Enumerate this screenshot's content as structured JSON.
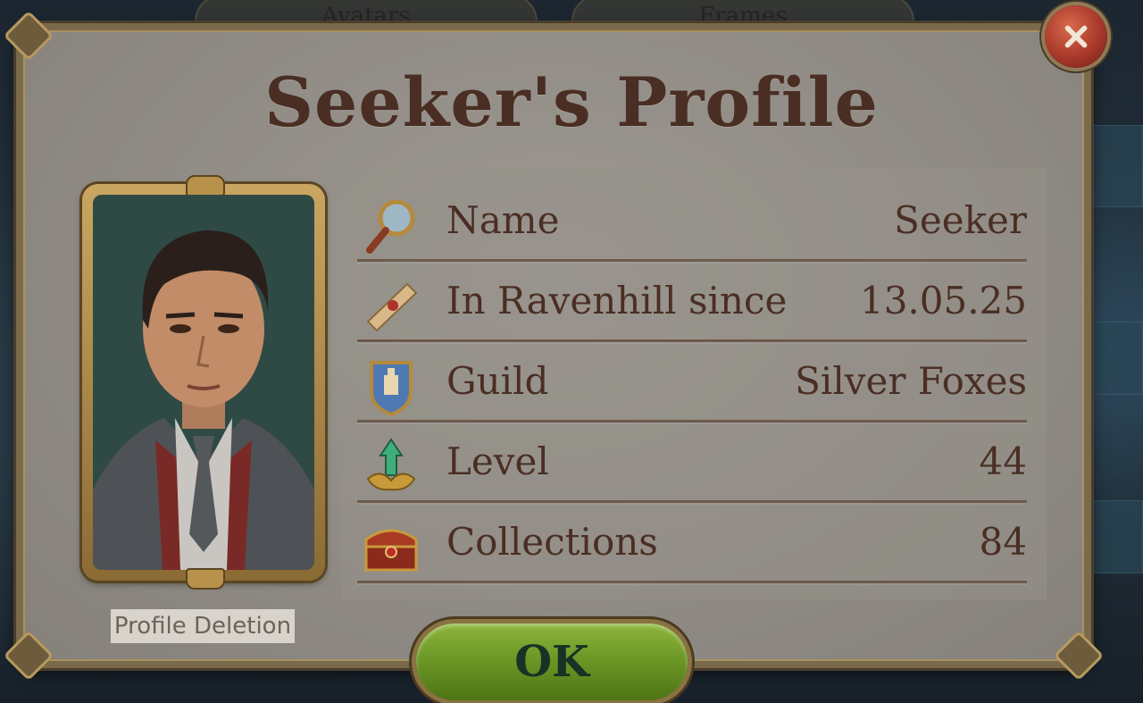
{
  "background": {
    "tabs": [
      "Avatars",
      "Frames"
    ]
  },
  "dialog": {
    "title": "Seeker's Profile",
    "close_icon": "close-x-icon",
    "ok_label": "OK",
    "profile_deletion_label": "Profile Deletion"
  },
  "profile": {
    "rows": [
      {
        "icon": "magnifying-glass-icon",
        "label": "Name",
        "value": "Seeker"
      },
      {
        "icon": "scroll-icon",
        "label": "In Ravenhill since",
        "value": "13.05.25"
      },
      {
        "icon": "guild-crest-icon",
        "label": "Guild",
        "value": "Silver Foxes"
      },
      {
        "icon": "level-emerald-icon",
        "label": "Level",
        "value": "44"
      },
      {
        "icon": "treasure-chest-icon",
        "label": "Collections",
        "value": "84"
      }
    ]
  },
  "colors": {
    "title_text": "#4a2e24",
    "ok_button": "#6a9524",
    "close_button": "#a8382a",
    "panel_frame": "#b79a5e"
  }
}
